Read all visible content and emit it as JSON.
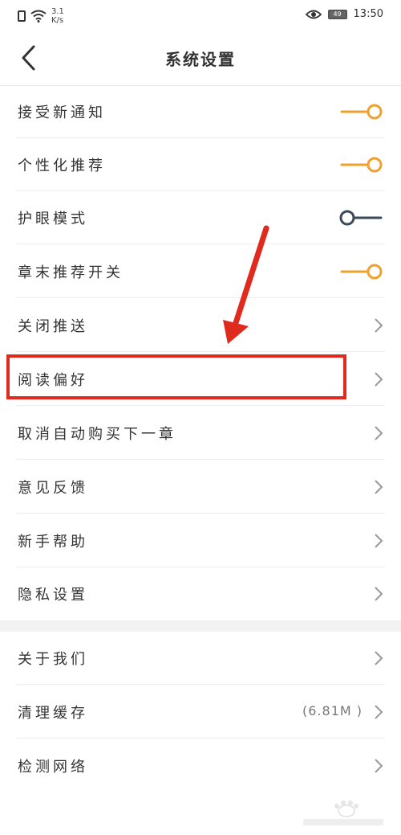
{
  "status_bar": {
    "speed_value": "3.1",
    "speed_unit": "K/s",
    "battery": "49",
    "time": "13:50"
  },
  "header": {
    "title": "系统设置"
  },
  "settings": [
    {
      "label": "接受新通知",
      "type": "toggle",
      "on": true
    },
    {
      "label": "个性化推荐",
      "type": "toggle",
      "on": true
    },
    {
      "label": "护眼模式",
      "type": "toggle",
      "on": false
    },
    {
      "label": "章末推荐开关",
      "type": "toggle",
      "on": true
    },
    {
      "label": "关闭推送",
      "type": "link"
    },
    {
      "label": "阅读偏好",
      "type": "link"
    },
    {
      "label": "取消自动购买下一章",
      "type": "link"
    },
    {
      "label": "意见反馈",
      "type": "link"
    },
    {
      "label": "新手帮助",
      "type": "link"
    },
    {
      "label": "隐私设置",
      "type": "link"
    }
  ],
  "settings2": [
    {
      "label": "关于我们",
      "type": "link"
    },
    {
      "label": "清理缓存",
      "type": "link",
      "extra": "(6.81M )"
    },
    {
      "label": "检测网络",
      "type": "link"
    }
  ],
  "colors": {
    "toggle_on": "#f0a02c",
    "toggle_off": "#3a4a5a",
    "annotation": "#e02a1e"
  }
}
